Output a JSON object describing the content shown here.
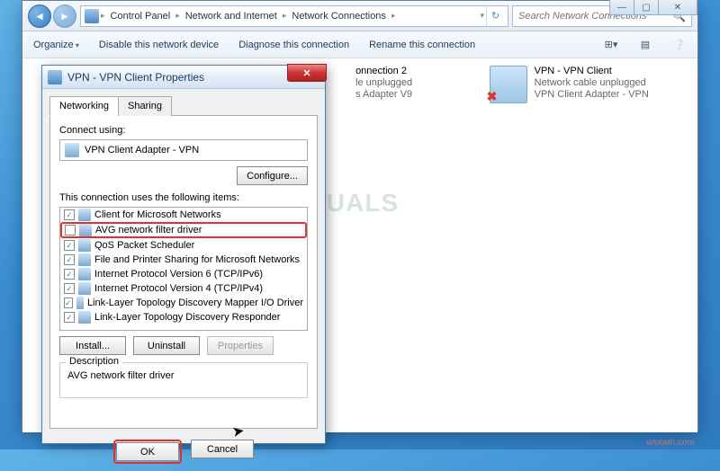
{
  "window": {
    "min": "—",
    "max": "▢",
    "close": "✕"
  },
  "addr": {
    "seg1": "Control Panel",
    "seg2": "Network and Internet",
    "seg3": "Network Connections",
    "search_placeholder": "Search Network Connections"
  },
  "cmd": {
    "organize": "Organize",
    "disable": "Disable this network device",
    "diagnose": "Diagnose this connection",
    "rename": "Rename this connection"
  },
  "conn1": {
    "name": "onnection 2",
    "line2": "le unplugged",
    "line3": "s Adapter V9"
  },
  "conn2": {
    "name": "VPN - VPN Client",
    "line2": "Network cable unplugged",
    "line3": "VPN Client Adapter - VPN"
  },
  "dialog": {
    "title": "VPN - VPN Client Properties",
    "tab1": "Networking",
    "tab2": "Sharing",
    "connect_using": "Connect using:",
    "adapter": "VPN Client Adapter - VPN",
    "configure": "Configure...",
    "uses_items": "This connection uses the following items:",
    "items": [
      {
        "checked": true,
        "label": "Client for Microsoft Networks"
      },
      {
        "checked": false,
        "label": "AVG network filter driver",
        "highlight": true
      },
      {
        "checked": true,
        "label": "QoS Packet Scheduler"
      },
      {
        "checked": true,
        "label": "File and Printer Sharing for Microsoft Networks"
      },
      {
        "checked": true,
        "label": "Internet Protocol Version 6 (TCP/IPv6)"
      },
      {
        "checked": true,
        "label": "Internet Protocol Version 4 (TCP/IPv4)"
      },
      {
        "checked": true,
        "label": "Link-Layer Topology Discovery Mapper I/O Driver"
      },
      {
        "checked": true,
        "label": "Link-Layer Topology Discovery Responder"
      }
    ],
    "install": "Install...",
    "uninstall": "Uninstall",
    "properties": "Properties",
    "desc_label": "Description",
    "desc_text": "AVG network filter driver",
    "ok": "OK",
    "cancel": "Cancel"
  },
  "watermark": "wsxwin.com",
  "logo_wm": "A   PUALS"
}
